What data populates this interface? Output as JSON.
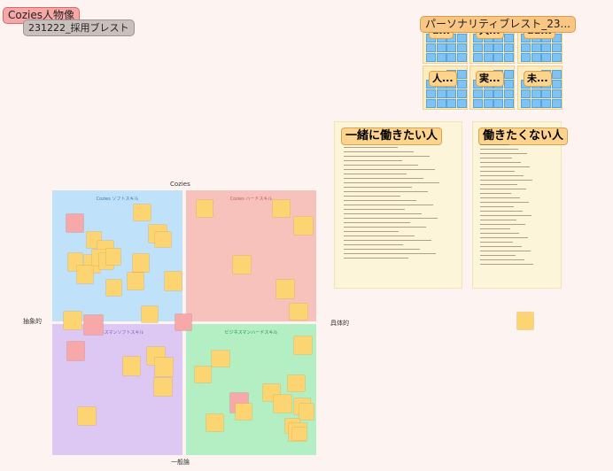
{
  "board": {
    "title_tag": "Cozies人物像",
    "subtitle_tag": "231222_採用ブレスト",
    "persona_tag": "パーソナリティブレスト_23...",
    "mini_frames": [
      {
        "label": "a..."
      },
      {
        "label": "人..."
      },
      {
        "label": "ad..."
      },
      {
        "label": "人..."
      },
      {
        "label": "実..."
      },
      {
        "label": "未..."
      }
    ]
  },
  "matrix": {
    "top_label": "Cozies",
    "bottom_label": "一般論",
    "left_label": "抽象的",
    "right_label": "具体的",
    "quadrants": [
      {
        "title": "Cozies ソフトスキル",
        "color": "#bfe1fa"
      },
      {
        "title": "Cozies ハードスキル",
        "color": "#f7c1bc"
      },
      {
        "title": "ビジネスマンソフトスキル",
        "color": "#ddc7f3"
      },
      {
        "title": "ビジネスマンハードスキル",
        "color": "#b3efc3"
      }
    ]
  },
  "want": {
    "title": "一緒に働きたい人"
  },
  "not_want": {
    "title": "働きたくない人"
  },
  "colors": {
    "note_yellow": "#fdd472",
    "note_pink": "#f7a8a8",
    "board_bg": "#fdf4f1"
  }
}
